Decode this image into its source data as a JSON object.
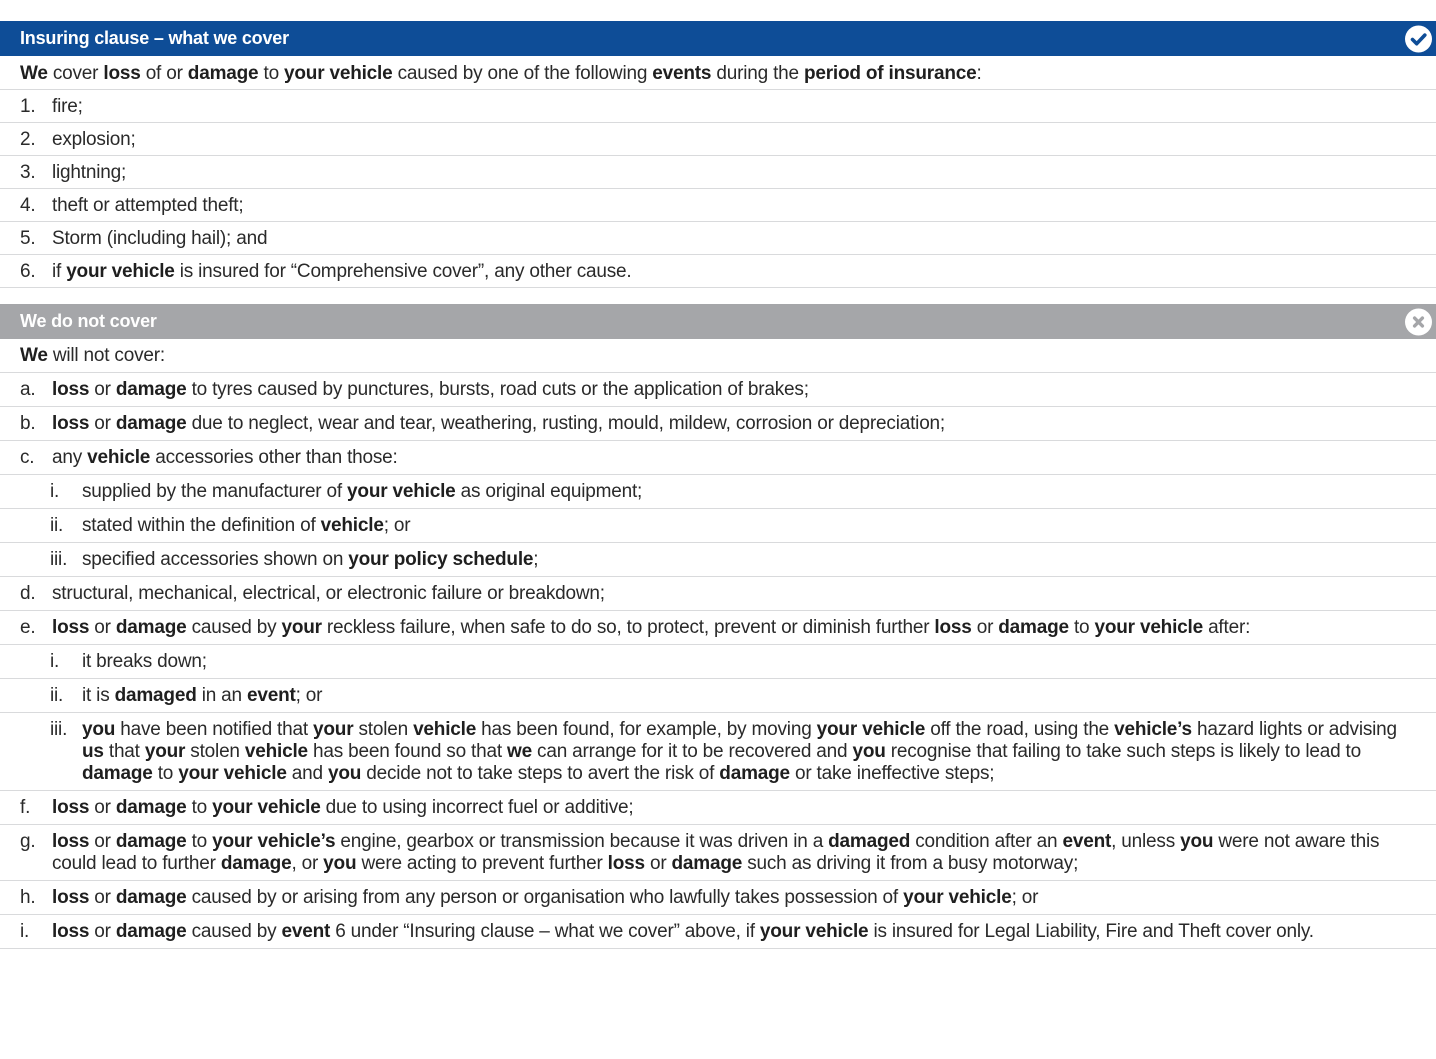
{
  "section1": {
    "title": "Insuring clause – what we cover",
    "icon": "check-circle-icon",
    "intro": [
      [
        "b",
        "We"
      ],
      [
        "t",
        " cover "
      ],
      [
        "b",
        "loss"
      ],
      [
        "t",
        " of or "
      ],
      [
        "b",
        "damage"
      ],
      [
        "t",
        " to "
      ],
      [
        "b",
        "your vehicle"
      ],
      [
        "t",
        " caused by one of the following "
      ],
      [
        "b",
        "events"
      ],
      [
        "t",
        " during the "
      ],
      [
        "b",
        "period of insurance"
      ],
      [
        "t",
        ":"
      ]
    ],
    "items": [
      {
        "marker": "1.",
        "text": [
          [
            "t",
            "fire;"
          ]
        ]
      },
      {
        "marker": "2.",
        "text": [
          [
            "t",
            "explosion;"
          ]
        ]
      },
      {
        "marker": "3.",
        "text": [
          [
            "t",
            "lightning;"
          ]
        ]
      },
      {
        "marker": "4.",
        "text": [
          [
            "t",
            "theft or attempted theft;"
          ]
        ]
      },
      {
        "marker": "5.",
        "text": [
          [
            "t",
            "Storm (including hail); and"
          ]
        ]
      },
      {
        "marker": "6.",
        "text": [
          [
            "t",
            "if "
          ],
          [
            "b",
            "your vehicle"
          ],
          [
            "t",
            " is insured for “Comprehensive cover”, any other cause."
          ]
        ]
      }
    ]
  },
  "section2": {
    "title": "We do not cover",
    "icon": "cross-circle-icon",
    "intro": [
      [
        "b",
        "We"
      ],
      [
        "t",
        " will not cover:"
      ]
    ],
    "items": [
      {
        "level": 1,
        "marker": "a.",
        "text": [
          [
            "b",
            "loss"
          ],
          [
            "t",
            " or "
          ],
          [
            "b",
            "damage"
          ],
          [
            "t",
            " to tyres caused by punctures, bursts, road cuts or the application of brakes;"
          ]
        ]
      },
      {
        "level": 1,
        "marker": "b.",
        "text": [
          [
            "b",
            "loss"
          ],
          [
            "t",
            " or "
          ],
          [
            "b",
            "damage"
          ],
          [
            "t",
            " due to neglect, wear and tear, weathering, rusting, mould, mildew, corrosion or depreciation;"
          ]
        ]
      },
      {
        "level": 1,
        "marker": "c.",
        "text": [
          [
            "t",
            "any "
          ],
          [
            "b",
            "vehicle"
          ],
          [
            "t",
            " accessories other than those:"
          ]
        ]
      },
      {
        "level": 2,
        "marker": "i.",
        "text": [
          [
            "t",
            "supplied by the manufacturer of "
          ],
          [
            "b",
            "your vehicle"
          ],
          [
            "t",
            " as original equipment;"
          ]
        ]
      },
      {
        "level": 2,
        "marker": "ii.",
        "text": [
          [
            "t",
            "stated within the definition of "
          ],
          [
            "b",
            "vehicle"
          ],
          [
            "t",
            "; or"
          ]
        ]
      },
      {
        "level": 2,
        "marker": "iii.",
        "text": [
          [
            "t",
            "specified accessories shown on "
          ],
          [
            "b",
            "your policy schedule"
          ],
          [
            "t",
            ";"
          ]
        ]
      },
      {
        "level": 1,
        "marker": "d.",
        "text": [
          [
            "t",
            "structural, mechanical, electrical, or electronic failure or breakdown;"
          ]
        ]
      },
      {
        "level": 1,
        "marker": "e.",
        "text": [
          [
            "b",
            "loss"
          ],
          [
            "t",
            " or "
          ],
          [
            "b",
            "damage"
          ],
          [
            "t",
            " caused by "
          ],
          [
            "b",
            "your"
          ],
          [
            "t",
            " reckless failure, when safe to do so, to protect, prevent or diminish further "
          ],
          [
            "b",
            "loss"
          ],
          [
            "t",
            " or "
          ],
          [
            "b",
            "damage"
          ],
          [
            "t",
            " to "
          ],
          [
            "b",
            "your vehicle"
          ],
          [
            "t",
            " after:"
          ]
        ]
      },
      {
        "level": 2,
        "marker": "i.",
        "text": [
          [
            "t",
            "it breaks down;"
          ]
        ]
      },
      {
        "level": 2,
        "marker": "ii.",
        "text": [
          [
            "t",
            "it is "
          ],
          [
            "b",
            "damaged"
          ],
          [
            "t",
            " in an "
          ],
          [
            "b",
            "event"
          ],
          [
            "t",
            "; or"
          ]
        ]
      },
      {
        "level": 2,
        "marker": "iii.",
        "text": [
          [
            "b",
            "you"
          ],
          [
            "t",
            " have been notified that "
          ],
          [
            "b",
            "your"
          ],
          [
            "t",
            " stolen "
          ],
          [
            "b",
            "vehicle"
          ],
          [
            "t",
            " has been found, for example, by moving "
          ],
          [
            "b",
            "your vehicle"
          ],
          [
            "t",
            " off the road, using the "
          ],
          [
            "b",
            "vehicle’s"
          ],
          [
            "t",
            " hazard lights or advising "
          ],
          [
            "b",
            "us"
          ],
          [
            "t",
            " that "
          ],
          [
            "b",
            "your"
          ],
          [
            "t",
            " stolen "
          ],
          [
            "b",
            "vehicle"
          ],
          [
            "t",
            " has been found so that "
          ],
          [
            "b",
            "we"
          ],
          [
            "t",
            " can arrange for it to be recovered and "
          ],
          [
            "b",
            "you"
          ],
          [
            "t",
            " recognise that failing to take such steps is likely to lead to "
          ],
          [
            "b",
            "damage"
          ],
          [
            "t",
            " to "
          ],
          [
            "b",
            "your vehicle"
          ],
          [
            "t",
            " and "
          ],
          [
            "b",
            "you"
          ],
          [
            "t",
            " decide not to take steps to avert the risk of "
          ],
          [
            "b",
            "damage"
          ],
          [
            "t",
            " or take ineffective steps;"
          ]
        ]
      },
      {
        "level": 1,
        "marker": "f.",
        "text": [
          [
            "b",
            "loss"
          ],
          [
            "t",
            " or "
          ],
          [
            "b",
            "damage"
          ],
          [
            "t",
            " to "
          ],
          [
            "b",
            "your vehicle"
          ],
          [
            "t",
            " due to using incorrect fuel or additive;"
          ]
        ]
      },
      {
        "level": 1,
        "marker": "g.",
        "text": [
          [
            "b",
            "loss"
          ],
          [
            "t",
            " or "
          ],
          [
            "b",
            "damage"
          ],
          [
            "t",
            " to "
          ],
          [
            "b",
            "your vehicle’s"
          ],
          [
            "t",
            " engine, gearbox or transmission because it was driven in a "
          ],
          [
            "b",
            "damaged"
          ],
          [
            "t",
            " condition after an "
          ],
          [
            "b",
            "event"
          ],
          [
            "t",
            ", unless "
          ],
          [
            "b",
            "you"
          ],
          [
            "t",
            " were not aware this could lead to further "
          ],
          [
            "b",
            "damage"
          ],
          [
            "t",
            ", or "
          ],
          [
            "b",
            "you"
          ],
          [
            "t",
            " were acting to prevent further "
          ],
          [
            "b",
            "loss"
          ],
          [
            "t",
            " or "
          ],
          [
            "b",
            "damage"
          ],
          [
            "t",
            " such as driving it from a busy motorway;"
          ]
        ]
      },
      {
        "level": 1,
        "marker": "h.",
        "text": [
          [
            "b",
            "loss"
          ],
          [
            "t",
            " or "
          ],
          [
            "b",
            "damage"
          ],
          [
            "t",
            " caused by or arising from any person or organisation who lawfully takes possession of "
          ],
          [
            "b",
            "your vehicle"
          ],
          [
            "t",
            "; or"
          ]
        ]
      },
      {
        "level": 1,
        "marker": "i.",
        "text": [
          [
            "b",
            "loss"
          ],
          [
            "t",
            " or "
          ],
          [
            "b",
            "damage"
          ],
          [
            "t",
            " caused by "
          ],
          [
            "b",
            "event"
          ],
          [
            "t",
            " 6 under “Insuring clause – what we cover” above, if "
          ],
          [
            "b",
            "your vehicle"
          ],
          [
            "t",
            " is insured for Legal Liability, Fire and Theft cover only."
          ]
        ]
      }
    ]
  }
}
